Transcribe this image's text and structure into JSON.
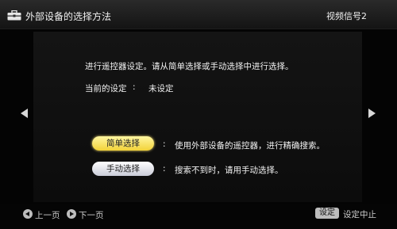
{
  "header": {
    "icon": "toolbox-icon",
    "title": "外部设备的选择方法",
    "input_source": "视频信号2"
  },
  "main": {
    "instruction": "进行遥控器设定。请从简单选择或手动选择中进行选择。",
    "current_setting": {
      "label": "当前的设定",
      "separator": ":",
      "value": "未设定"
    },
    "options": [
      {
        "label": "简单选择",
        "separator": ":",
        "description": "使用外部设备的遥控器，进行精确搜索。",
        "highlighted": true
      },
      {
        "label": "手动选择",
        "separator": ":",
        "description": "搜索不到时，请用手动选择。",
        "highlighted": false
      }
    ],
    "nav": {
      "left_icon": "arrow-left-icon",
      "right_icon": "arrow-right-icon"
    }
  },
  "footer": {
    "prev_label": "上一页",
    "next_label": "下一页",
    "setting_key": "设定",
    "setting_desc": "设定中止"
  },
  "colors": {
    "highlight_button": "#f2d238",
    "normal_button": "#c9ccd8",
    "background": "#040404"
  }
}
